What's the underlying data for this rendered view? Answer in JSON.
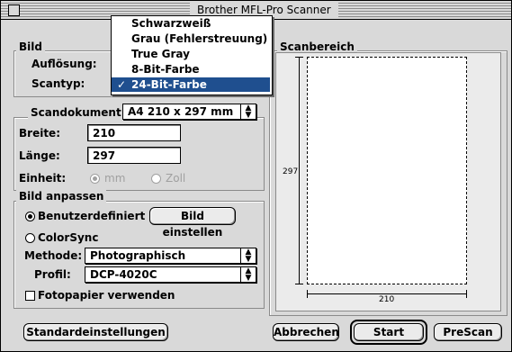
{
  "window": {
    "title": "Brother MFL-Pro Scanner"
  },
  "image_group": {
    "legend": "Bild",
    "resolution_label": "Auflösung:",
    "scantype_label": "Scantyp:"
  },
  "scantype_menu": {
    "items": [
      "Schwarzweiß",
      "Grau (Fehlerstreuung)",
      "True Gray",
      "8-Bit-Farbe",
      "24-Bit-Farbe"
    ],
    "selected_index": 4,
    "checkmark": "✓"
  },
  "scan_document": {
    "label": "Scandokument",
    "size_value": "A4 210 x 297 mm",
    "width_label": "Breite:",
    "width_value": "210",
    "length_label": "Länge:",
    "length_value": "297",
    "unit_label": "Einheit:",
    "unit_mm": "mm",
    "unit_zoll": "Zoll",
    "unit_selected": "mm"
  },
  "adjust": {
    "legend": "Bild anpassen",
    "custom_label": "Benutzerdefiniert",
    "custom_selected": true,
    "set_image_button": "Bild einstellen",
    "colorsync_label": "ColorSync",
    "method_label": "Methode:",
    "method_value": "Photographisch",
    "profile_label": "Profil:",
    "profile_value": "DCP-4020C",
    "photo_paper_label": "Fotopapier verwenden",
    "photo_paper_checked": false
  },
  "scan_area": {
    "legend": "Scanbereich",
    "height_label": "297",
    "width_label": "210"
  },
  "buttons": {
    "defaults": "Standardeinstellungen",
    "cancel": "Abbrechen",
    "start": "Start",
    "prescan": "PreScan"
  }
}
